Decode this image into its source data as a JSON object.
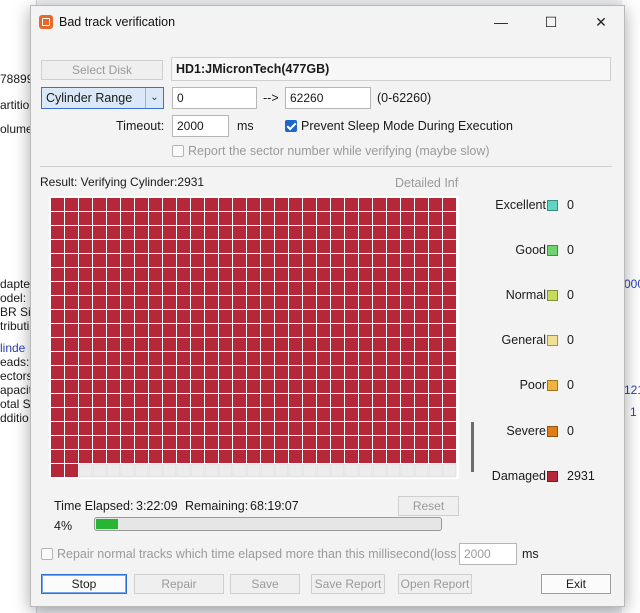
{
  "background": {
    "lines": [
      "78899",
      "artitio",
      "olume",
      "dapte",
      "odel:",
      "BR Si",
      "tributi",
      "linde",
      "eads:",
      "ectors",
      "apacit",
      "otal Se",
      "dditio"
    ],
    "right_values": [
      "000",
      "121",
      "1"
    ]
  },
  "window": {
    "title": "Bad track verification",
    "minimize_label": "—",
    "maximize_label": "☐",
    "close_label": "✕"
  },
  "disk": {
    "select_disk_label": "Select Disk",
    "disk_name": "HD1:JMicronTech(477GB)"
  },
  "range": {
    "mode_selected": "Cylinder Range",
    "start": "0",
    "arrow": "-->",
    "end": "62260",
    "bounds": "(0-62260)"
  },
  "options": {
    "timeout_label": "Timeout:",
    "timeout_value": "2000",
    "timeout_unit": "ms",
    "prevent_sleep_label": "Prevent Sleep Mode During Execution",
    "prevent_sleep_checked": true,
    "report_sector_label": "Report the sector number while verifying (maybe slow)",
    "report_sector_checked": false
  },
  "result": {
    "status_text": "Result: Verifying Cylinder:2931",
    "detailed_info_label": "Detailed Info"
  },
  "grid": {
    "columns": 29,
    "rows": 20,
    "damaged_blocks": 553,
    "damaged_color": "#b5283a",
    "empty_color": "#ececec"
  },
  "legend": [
    {
      "name": "Excellent",
      "count": "0",
      "color": "#5fd6c4"
    },
    {
      "name": "Good",
      "count": "0",
      "color": "#6fd36f"
    },
    {
      "name": "Normal",
      "count": "0",
      "color": "#c6dc5e"
    },
    {
      "name": "General",
      "count": "0",
      "color": "#f1df95"
    },
    {
      "name": "Poor",
      "count": "0",
      "color": "#f2b33a"
    },
    {
      "name": "Severe",
      "count": "0",
      "color": "#e07d14"
    },
    {
      "name": "Damaged",
      "count": "2931",
      "color": "#b5283a"
    }
  ],
  "timing": {
    "elapsed_label": "Time Elapsed:",
    "elapsed_value": "3:22:09",
    "remaining_label": "Remaining:",
    "remaining_value": "68:19:07",
    "reset_label": "Reset",
    "percent_text": "4%",
    "progress_fraction": 0.04
  },
  "repair": {
    "label": "Repair normal tracks which time elapsed more than this millisecond(lossle",
    "value": "2000",
    "unit": "ms",
    "checked": false
  },
  "buttons": {
    "stop": "Stop",
    "repair": "Repair",
    "save": "Save",
    "save_report": "Save Report",
    "open_report": "Open Report",
    "exit": "Exit"
  }
}
